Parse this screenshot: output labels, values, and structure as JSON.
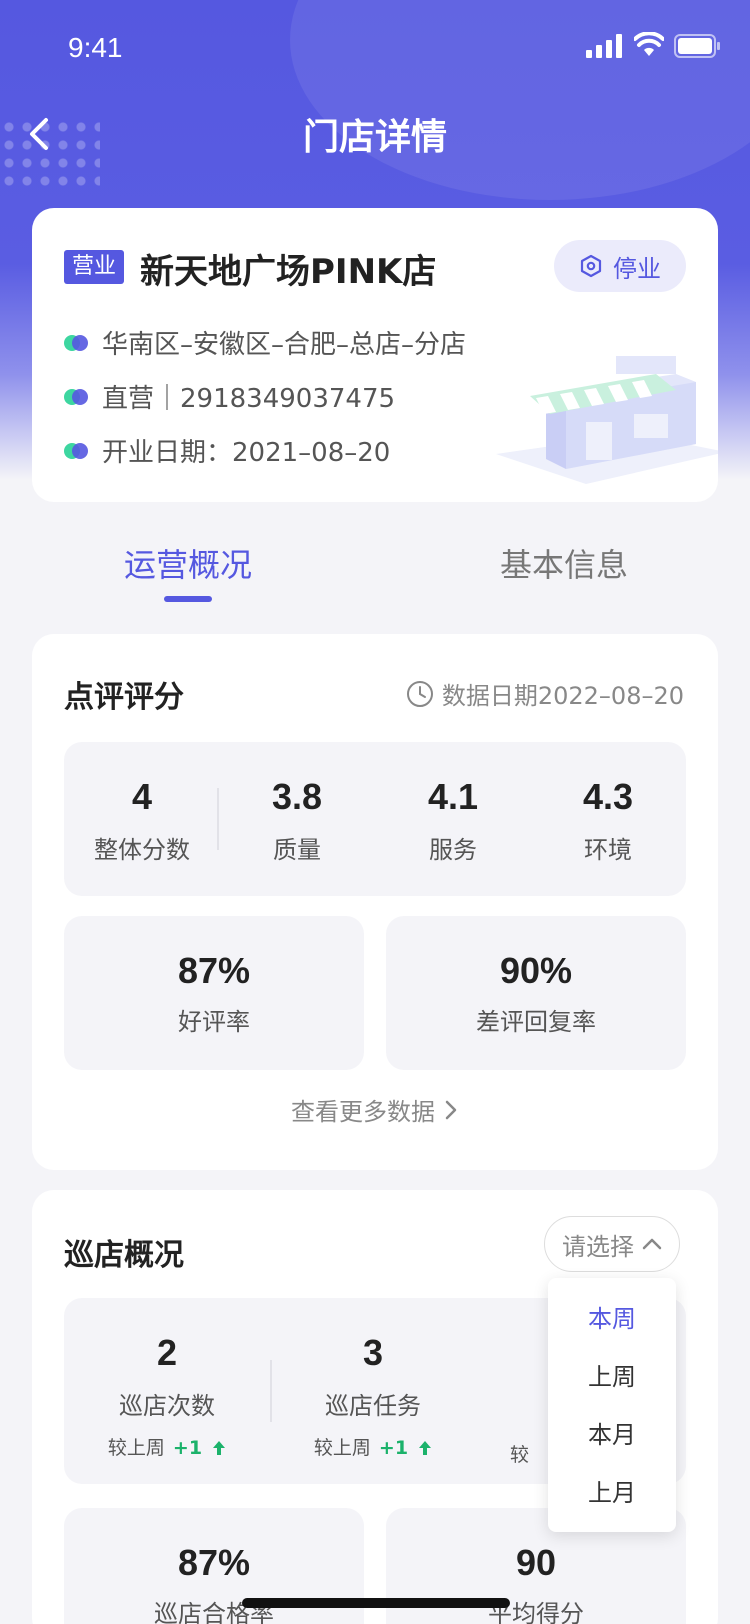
{
  "status_bar": {
    "time": "9:41"
  },
  "nav": {
    "title": "门店详情"
  },
  "store": {
    "status_badge": "营业",
    "name": "新天地广场PINK店",
    "stop_label": "停业",
    "region": "华南区–安徽区–合肥–总店–分店",
    "type_and_code": "直营｜2918349037475",
    "open_date": "开业日期：2021–08–20"
  },
  "tabs": [
    {
      "label": "运营概况",
      "active": true
    },
    {
      "label": "基本信息",
      "active": false
    }
  ],
  "review": {
    "title": "点评评分",
    "data_date": "数据日期2022–08–20",
    "scores": [
      {
        "value": "4",
        "label": "整体分数"
      },
      {
        "value": "3.8",
        "label": "质量"
      },
      {
        "value": "4.1",
        "label": "服务"
      },
      {
        "value": "4.3",
        "label": "环境"
      }
    ],
    "rates": [
      {
        "value": "87%",
        "label": "好评率"
      },
      {
        "value": "90%",
        "label": "差评回复率"
      }
    ],
    "more_label": "查看更多数据"
  },
  "patrol": {
    "title": "巡店概况",
    "select_placeholder": "请选择",
    "stats": [
      {
        "value": "2",
        "label": "巡店次数",
        "compare_label": "较上周",
        "delta": "+1"
      },
      {
        "value": "3",
        "label": "巡店任务",
        "compare_label": "较上周",
        "delta": "+1"
      },
      {
        "compare_label": "较"
      }
    ],
    "bottom": [
      {
        "value": "87%",
        "label": "巡店合格率"
      },
      {
        "value": "90",
        "label": "平均得分"
      }
    ]
  },
  "dropdown": {
    "options": [
      "本周",
      "上周",
      "本月",
      "上月"
    ],
    "selected": "本周"
  },
  "colors": {
    "primary": "#5558e0",
    "accent_green": "#3dd6a0",
    "positive": "#1bb26b",
    "background": "#f4f4f8"
  }
}
